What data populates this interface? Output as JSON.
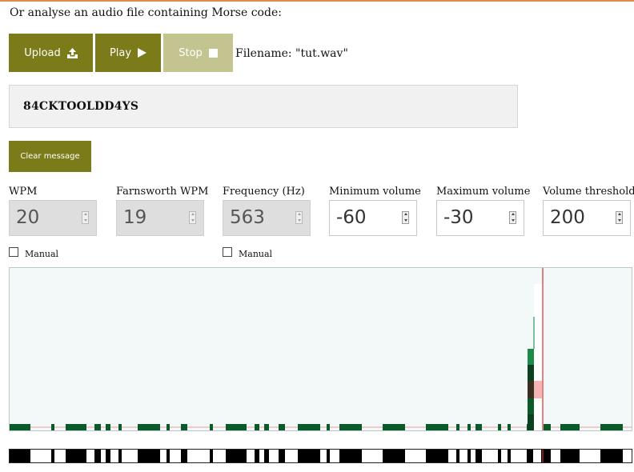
{
  "intro_text": "Or analyse an audio file containing Morse code:",
  "buttons": {
    "upload": "Upload",
    "play": "Play",
    "stop": "Stop"
  },
  "filename": "Filename: \"tut.wav\"",
  "message": "84CKTOOLDD4YS",
  "clear_button": "Clear message",
  "fields": {
    "wpm": {
      "label": "WPM",
      "value": "20",
      "disabled": true
    },
    "farnsworth": {
      "label": "Farnsworth WPM",
      "value": "19",
      "disabled": true
    },
    "frequency": {
      "label": "Frequency (Hz)",
      "value": "563",
      "disabled": true
    },
    "min_volume": {
      "label": "Minimum volume",
      "value": "-60",
      "disabled": false
    },
    "max_volume": {
      "label": "Maximum volume",
      "value": "-30",
      "disabled": false
    },
    "threshold": {
      "label": "Volume threshold",
      "value": "200",
      "disabled": false
    }
  },
  "manual_wpm": {
    "label": "Manual",
    "checked": false
  },
  "manual_frequency": {
    "label": "Manual",
    "checked": false
  },
  "colors": {
    "button": "#7b7b1a",
    "button_disabled": "#c3c48f",
    "signal_on": "#0a5a2a",
    "signal_strong": "#1e8a4a",
    "playhead": "#d03030",
    "spectrum_bg": "#f3f9f9"
  },
  "spectrum": {
    "signal_segments": [
      [
        0,
        26
      ],
      [
        52,
        56
      ],
      [
        70,
        96
      ],
      [
        106,
        114
      ],
      [
        120,
        126
      ],
      [
        136,
        140
      ],
      [
        160,
        188
      ],
      [
        196,
        200
      ],
      [
        214,
        222
      ],
      [
        250,
        254
      ],
      [
        270,
        296
      ],
      [
        306,
        312
      ],
      [
        318,
        324
      ],
      [
        336,
        344
      ],
      [
        360,
        388
      ],
      [
        396,
        400
      ],
      [
        412,
        440
      ],
      [
        466,
        494
      ],
      [
        520,
        548
      ],
      [
        558,
        562
      ],
      [
        572,
        576
      ],
      [
        582,
        590
      ],
      [
        610,
        614
      ],
      [
        622,
        626
      ],
      [
        646,
        654
      ],
      [
        664,
        676
      ],
      [
        688,
        712
      ],
      [
        738,
        766
      ]
    ],
    "burst_level": 0.7,
    "playhead_position": 0.857
  },
  "timeline": {
    "segments": [
      [
        0,
        26
      ],
      [
        52,
        56
      ],
      [
        70,
        96
      ],
      [
        106,
        114
      ],
      [
        120,
        126
      ],
      [
        136,
        140
      ],
      [
        160,
        188
      ],
      [
        196,
        200
      ],
      [
        214,
        222
      ],
      [
        250,
        254
      ],
      [
        270,
        296
      ],
      [
        306,
        312
      ],
      [
        318,
        324
      ],
      [
        336,
        344
      ],
      [
        360,
        388
      ],
      [
        396,
        400
      ],
      [
        412,
        440
      ],
      [
        466,
        494
      ],
      [
        520,
        548
      ],
      [
        558,
        562
      ],
      [
        572,
        576
      ],
      [
        582,
        590
      ],
      [
        610,
        614
      ],
      [
        622,
        626
      ],
      [
        646,
        654
      ],
      [
        664,
        676
      ],
      [
        688,
        712
      ],
      [
        738,
        766
      ]
    ]
  }
}
